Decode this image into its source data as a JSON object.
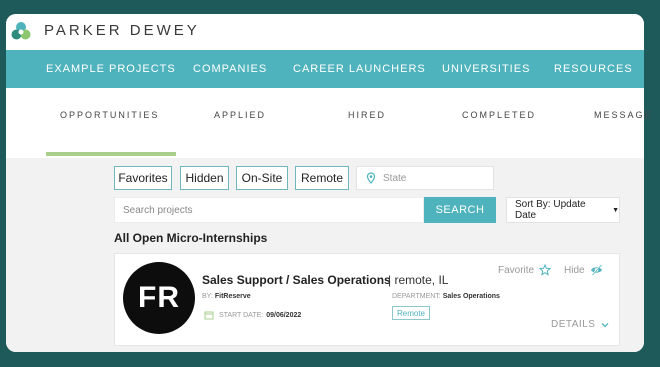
{
  "brand": {
    "name": "PARKER DEWEY"
  },
  "main_nav": [
    {
      "label": "EXAMPLE PROJECTS"
    },
    {
      "label": "COMPANIES"
    },
    {
      "label": "CAREER LAUNCHERS"
    },
    {
      "label": "UNIVERSITIES"
    },
    {
      "label": "RESOURCES"
    }
  ],
  "sub_tabs": [
    {
      "label": "OPPORTUNITIES",
      "active": true
    },
    {
      "label": "APPLIED"
    },
    {
      "label": "HIRED"
    },
    {
      "label": "COMPLETED"
    },
    {
      "label": "MESSAGE"
    }
  ],
  "filters": [
    {
      "label": "Favorites"
    },
    {
      "label": "Hidden"
    },
    {
      "label": "On-Site"
    },
    {
      "label": "Remote"
    }
  ],
  "state_filter": {
    "placeholder": "State"
  },
  "search": {
    "placeholder": "Search projects",
    "button_label": "SEARCH"
  },
  "sort": {
    "label": "Sort By: Update Date"
  },
  "section_title": "All Open Micro-Internships",
  "card": {
    "avatar_text": "FR",
    "title": "Sales Support / Sales Operations",
    "location": "| remote, IL",
    "by_label": "BY:",
    "company": "FitReserve",
    "department_label": "DEPARTMENT:",
    "department": "Sales Operations",
    "start_label": "START DATE:",
    "start_date": "09/06/2022",
    "tag": "Remote",
    "favorite_label": "Favorite",
    "hide_label": "Hide",
    "details_label": "DETAILS"
  },
  "colors": {
    "outer_bg": "#1f5a5a",
    "nav_teal": "#4fb3bd",
    "tab_underline": "#a8cf8c",
    "content_bg": "#f2f2f2"
  },
  "icons": [
    "logo-icon",
    "location-pin-icon",
    "caret-down-icon",
    "calendar-icon",
    "star-icon",
    "eye-hide-icon",
    "chevron-down-icon"
  ]
}
